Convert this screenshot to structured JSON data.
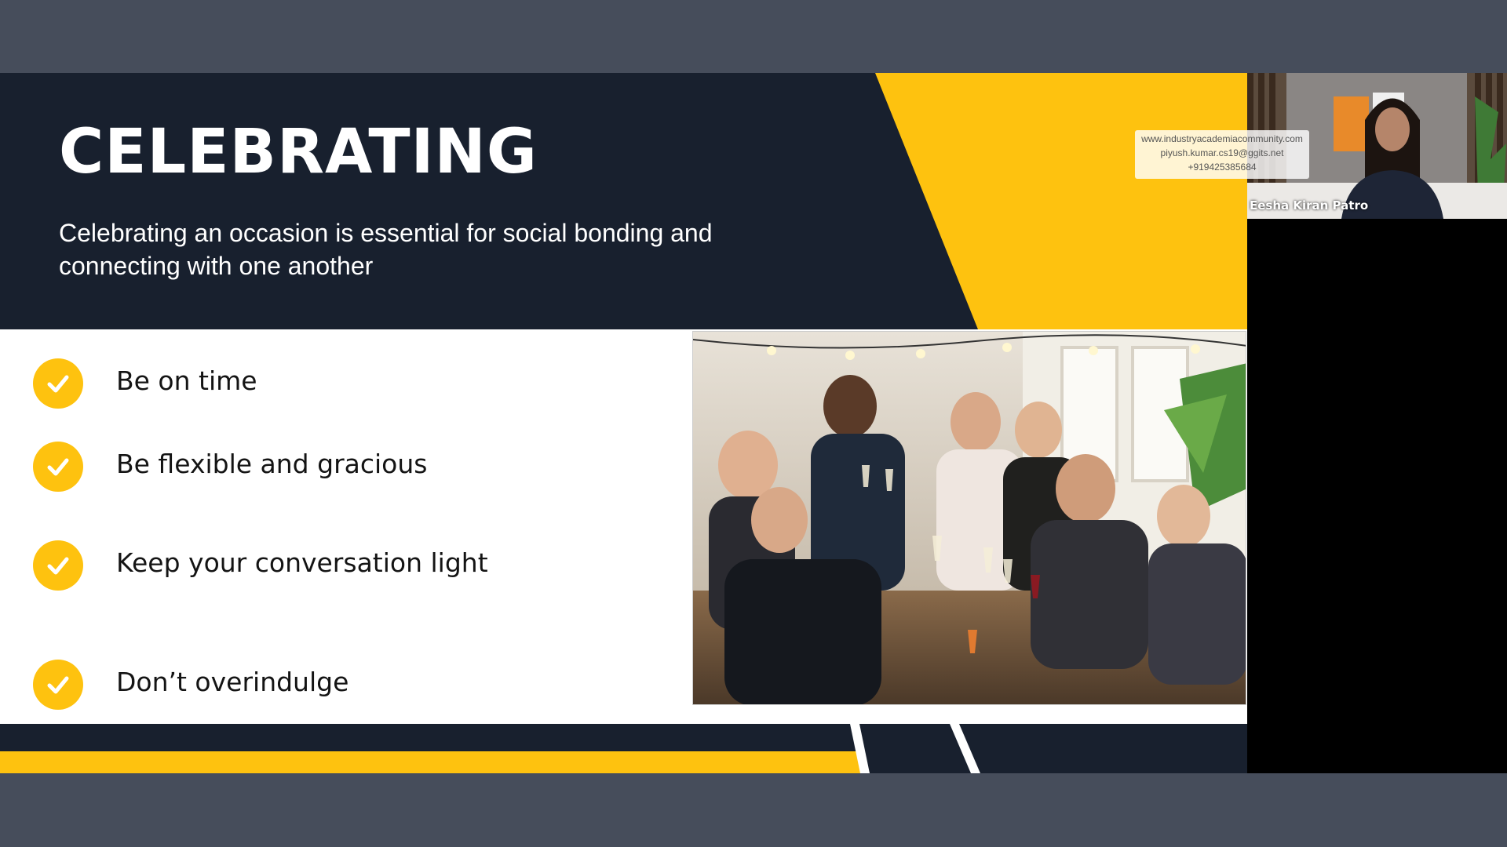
{
  "slide": {
    "title": "CELEBRATING",
    "subtitle": "Celebrating an occasion is essential for social bonding and connecting with one another",
    "checklist": [
      {
        "label": "Be on time",
        "icon": "check-icon"
      },
      {
        "label": "Be flexible and gracious",
        "icon": "check-icon"
      },
      {
        "label": "Keep your conversation light",
        "icon": "check-icon"
      },
      {
        "label": "Don’t overindulge",
        "icon": "check-icon"
      }
    ],
    "colors": {
      "navy": "#18202e",
      "yellow": "#fec20f",
      "frame": "#464d5b"
    }
  },
  "participant": {
    "name": "Eesha Kiran Patro"
  },
  "watermark": {
    "website": "www.industryacademiacommunity.com",
    "email": "piyush.kumar.cs19@ggits.net",
    "phone": "+919425385684"
  }
}
